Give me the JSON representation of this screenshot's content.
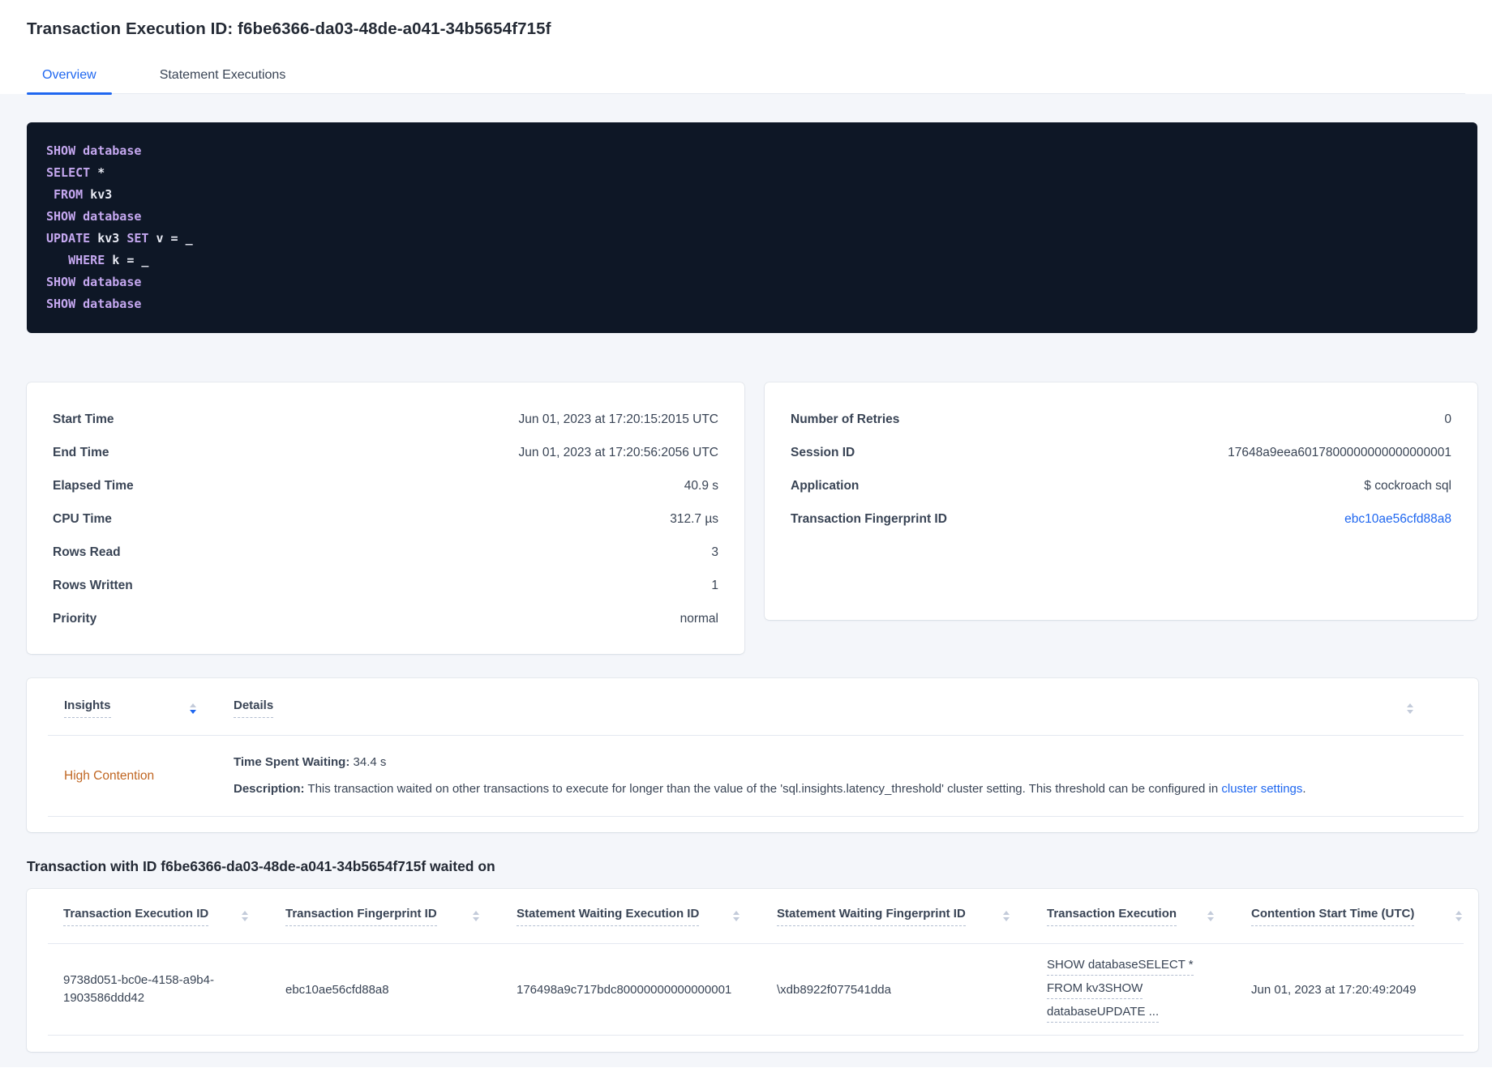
{
  "page": {
    "title": "Transaction Execution ID: f6be6366-da03-48de-a041-34b5654f715f"
  },
  "tabs": [
    {
      "label": "Overview",
      "active": true
    },
    {
      "label": "Statement Executions",
      "active": false
    }
  ],
  "colors": {
    "accent_blue": "#1f67f0",
    "insight_orange": "#c06622",
    "code_background": "#0e1726",
    "code_keyword": "#c5a8f0",
    "code_text": "#e7e9f2"
  },
  "sql": {
    "lines": [
      [
        {
          "t": "SHOW database",
          "kw": true
        }
      ],
      [
        {
          "t": "SELECT",
          "kw": true
        },
        {
          "t": " *"
        }
      ],
      [
        {
          "t": " "
        },
        {
          "t": "FROM",
          "kw": true
        },
        {
          "t": " kv3"
        }
      ],
      [
        {
          "t": "SHOW database",
          "kw": true
        }
      ],
      [
        {
          "t": "UPDATE",
          "kw": true
        },
        {
          "t": " kv3 "
        },
        {
          "t": "SET",
          "kw": true
        },
        {
          "t": " v = _"
        }
      ],
      [
        {
          "t": "   "
        },
        {
          "t": "WHERE",
          "kw": true
        },
        {
          "t": " k = _"
        }
      ],
      [
        {
          "t": "SHOW database",
          "kw": true
        }
      ],
      [
        {
          "t": "SHOW database",
          "kw": true
        }
      ]
    ]
  },
  "summary_left": {
    "rows": [
      {
        "label": "Start Time",
        "value": "Jun 01, 2023 at 17:20:15:2015 UTC"
      },
      {
        "label": "End Time",
        "value": "Jun 01, 2023 at 17:20:56:2056 UTC"
      },
      {
        "label": "Elapsed Time",
        "value": "40.9 s"
      },
      {
        "label": "CPU Time",
        "value": "312.7 µs"
      },
      {
        "label": "Rows Read",
        "value": "3"
      },
      {
        "label": "Rows Written",
        "value": "1"
      },
      {
        "label": "Priority",
        "value": "normal"
      }
    ]
  },
  "summary_right": {
    "rows": [
      {
        "label": "Number of Retries",
        "value": "0"
      },
      {
        "label": "Session ID",
        "value": "17648a9eea6017800000000000000001"
      },
      {
        "label": "Application",
        "value": "$ cockroach sql"
      },
      {
        "label": "Transaction Fingerprint ID",
        "value": "ebc10ae56cfd88a8"
      }
    ]
  },
  "insights": {
    "col_insights": "Insights",
    "col_details": "Details",
    "row": {
      "insight": "High Contention",
      "waiting_label": "Time Spent Waiting:",
      "waiting_value": " 34.4 s",
      "description_label": "Description:",
      "description_text": " This transaction waited on other transactions to execute for longer than the value of the 'sql.insights.latency_threshold' cluster setting. This threshold can be configured in ",
      "link_text": "cluster settings",
      "period": "."
    }
  },
  "waited": {
    "heading": "Transaction with ID f6be6366-da03-48de-a041-34b5654f715f waited on",
    "columns": [
      "Transaction Execution ID",
      "Transaction Fingerprint ID",
      "Statement Waiting Execution ID",
      "Statement Waiting Fingerprint ID",
      "Transaction Execution",
      "Contention Start Time (UTC)"
    ],
    "row": {
      "transaction_execution_id": "9738d051-bc0e-4158-a9b4-1903586ddd42",
      "transaction_fingerprint_id": "ebc10ae56cfd88a8",
      "statement_waiting_execution_id": "176498a9c717bdc80000000000000001",
      "statement_waiting_fingerprint_id": "\\xdb8922f077541dda",
      "transaction_execution_lines": [
        "SHOW databaseSELECT *",
        "FROM kv3SHOW",
        "databaseUPDATE ..."
      ],
      "contention_start_time": "Jun 01, 2023 at 17:20:49:2049"
    }
  }
}
